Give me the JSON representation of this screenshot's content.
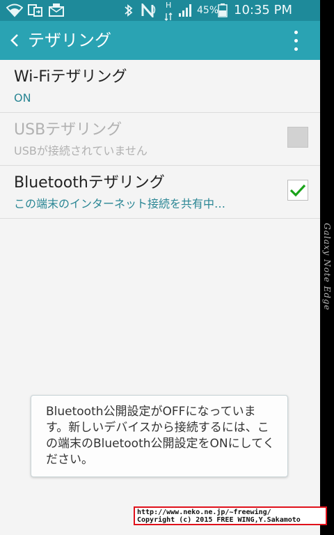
{
  "status_bar": {
    "icons": [
      "wifi-icon",
      "screen-mirror-icon",
      "email-icon",
      "bluetooth-icon",
      "nfc-icon",
      "hspa-icon",
      "signal-icon",
      "battery-icon"
    ],
    "network_type": "H",
    "battery_percent": "45%",
    "clock": "10:35 PM"
  },
  "action_bar": {
    "title": "テザリング",
    "icons": [
      "back-chevron-icon",
      "overflow-menu-icon"
    ]
  },
  "list": {
    "items": [
      {
        "title": "Wi-Fiテザリング",
        "summary": "ON",
        "enabled": true,
        "checkbox": false
      },
      {
        "title": "USBテザリング",
        "summary": "USBが接続されていません",
        "enabled": false,
        "checkbox": true,
        "checked": false
      },
      {
        "title": "Bluetoothテザリング",
        "summary": "この端末のインターネット接続を共有中…",
        "enabled": true,
        "checkbox": true,
        "checked": true
      }
    ]
  },
  "toast": {
    "message": "Bluetooth公開設定がOFFになっています。新しいデバイスから接続するには、この端末のBluetooth公開設定をONにしてください。"
  },
  "device_edge": {
    "label": "Galaxy Note Edge"
  },
  "watermark": {
    "line1": "http://www.neko.ne.jp/~freewing/",
    "line2": "Copyright (c) 2015 FREE WING,Y.Sakamoto"
  },
  "colors": {
    "status_bar": "#1e8a9a",
    "action_bar": "#2aa3b3",
    "accent": "#2a8694",
    "check": "#1aa31a",
    "background": "#f4f4f4",
    "watermark_border": "#e0101a"
  }
}
